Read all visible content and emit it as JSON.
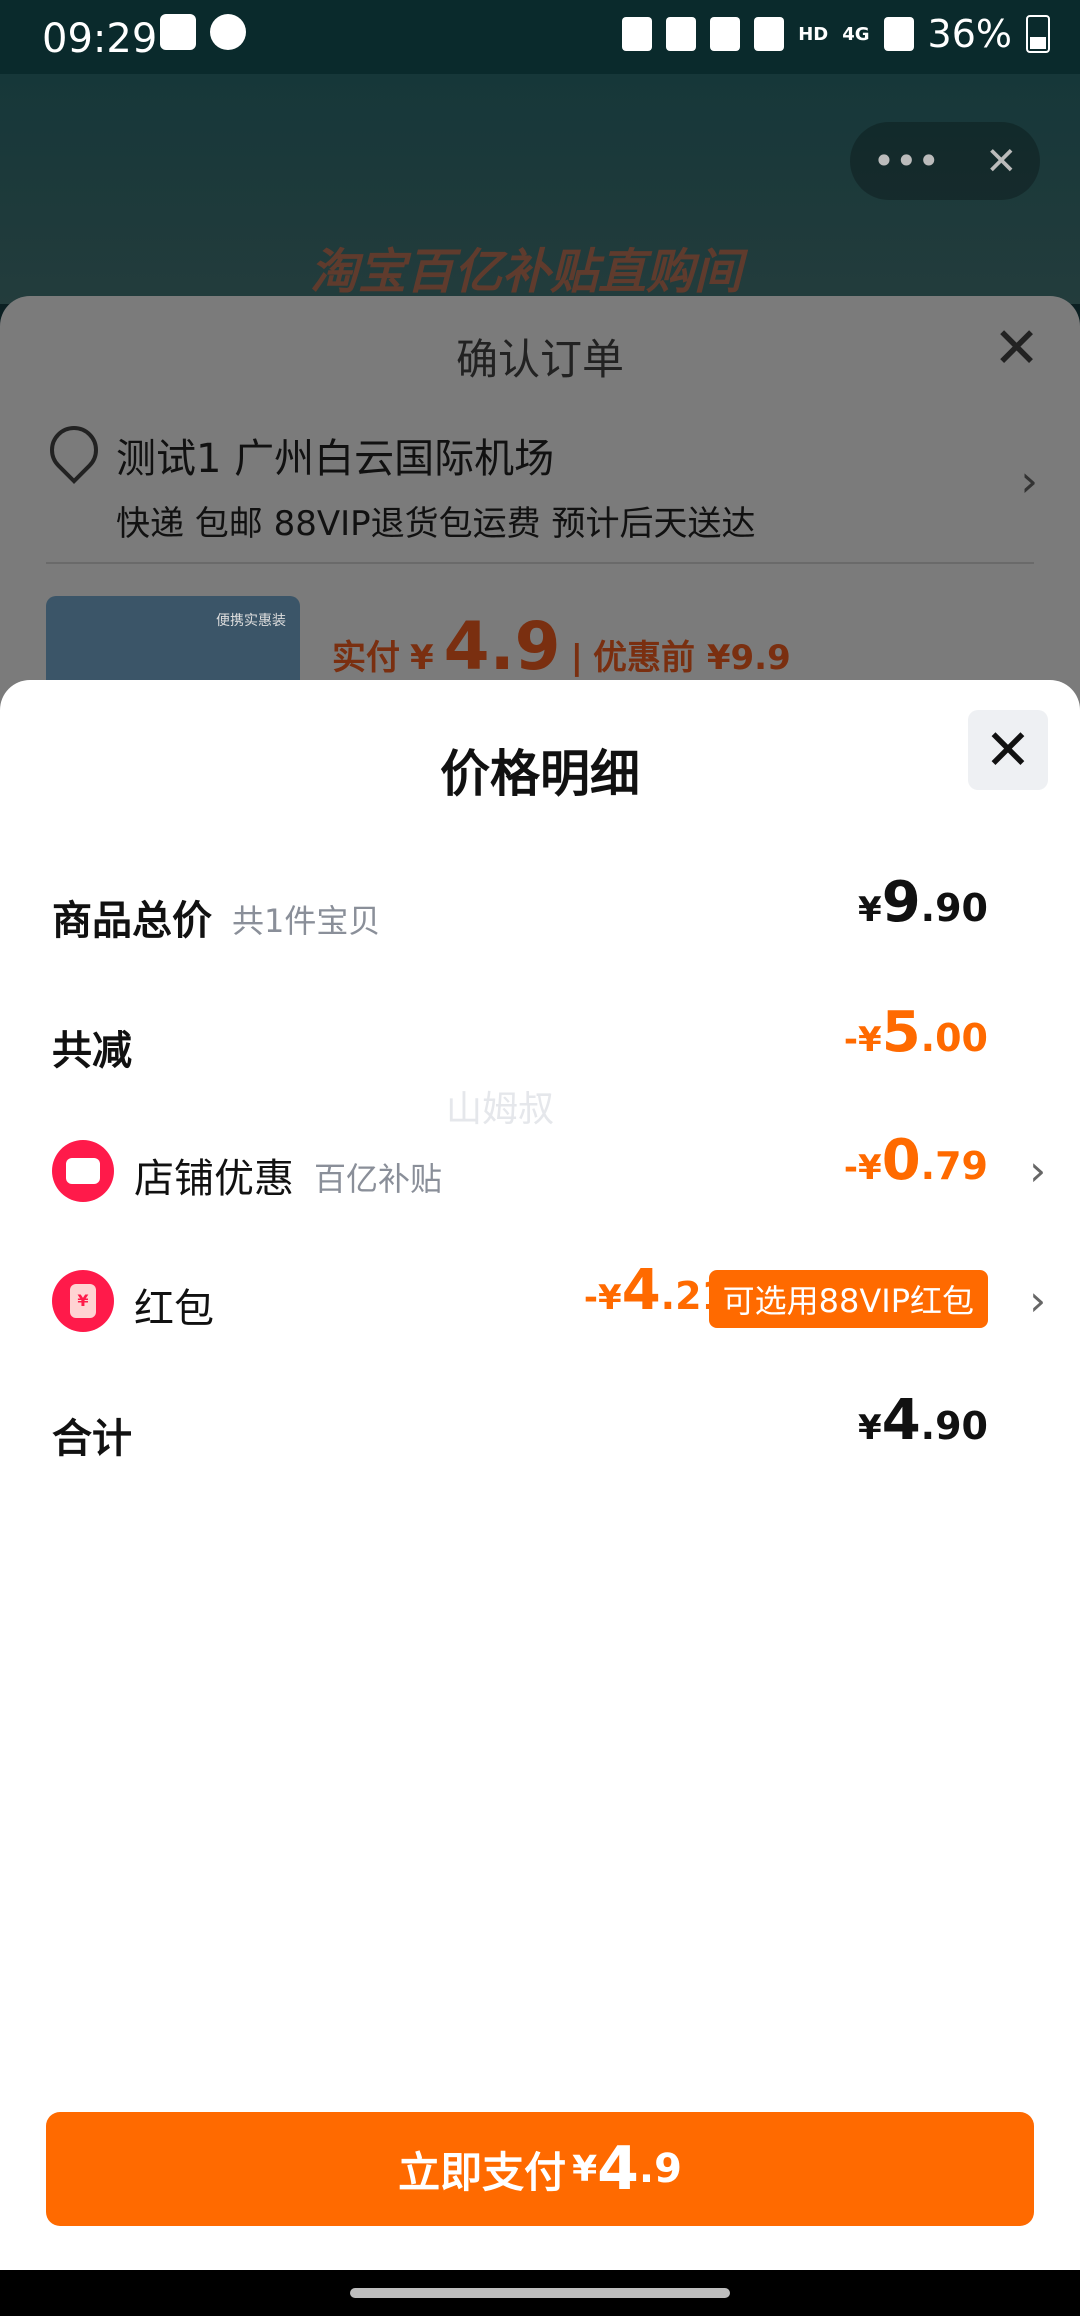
{
  "status_bar": {
    "time": "09:29",
    "battery": "36%",
    "network": "4G",
    "hd": "HD"
  },
  "background": {
    "capsule": {
      "more": "•••",
      "close": "✕"
    },
    "banner": "淘宝百亿补贴直购间",
    "sheet_title": "确认订单",
    "close": "✕",
    "address": "测试1 广州白云国际机场",
    "address_sub": "快递 包邮 88VIP退货包运费 预计后天送达",
    "thumb_label": "便携实惠装",
    "pay_label": "实付",
    "pay_currency": "¥",
    "pay_amount": "4.9",
    "pay_sep": "|",
    "orig_label": "优惠前 ¥9.9",
    "chevron": "›"
  },
  "modal": {
    "title": "价格明细",
    "close": "✕",
    "total": {
      "label": "商品总价",
      "sub": "共1件宝贝",
      "cur": "¥",
      "int": "9",
      "dec": ".90"
    },
    "discount": {
      "label": "共减",
      "cur": "-¥",
      "int": "5",
      "dec": ".00"
    },
    "store": {
      "label": "店铺优惠",
      "sub": "百亿补贴",
      "cur": "-¥",
      "int": "0",
      "dec": ".79",
      "chevron": "›"
    },
    "redpack": {
      "label": "红包",
      "cur": "-¥",
      "int": "4",
      "dec": ".21",
      "badge": "可选用88VIP红包",
      "chevron": "›",
      "icon_char": "¥"
    },
    "sum": {
      "label": "合计",
      "cur": "¥",
      "int": "4",
      "dec": ".90"
    },
    "watermark": "山姆叔",
    "pay_button": {
      "text": "立即支付",
      "cur": "¥",
      "int": "4",
      "dec": ".9"
    }
  },
  "colors": {
    "accent": "#ff6a00",
    "redpack": "#ff1a4a"
  }
}
